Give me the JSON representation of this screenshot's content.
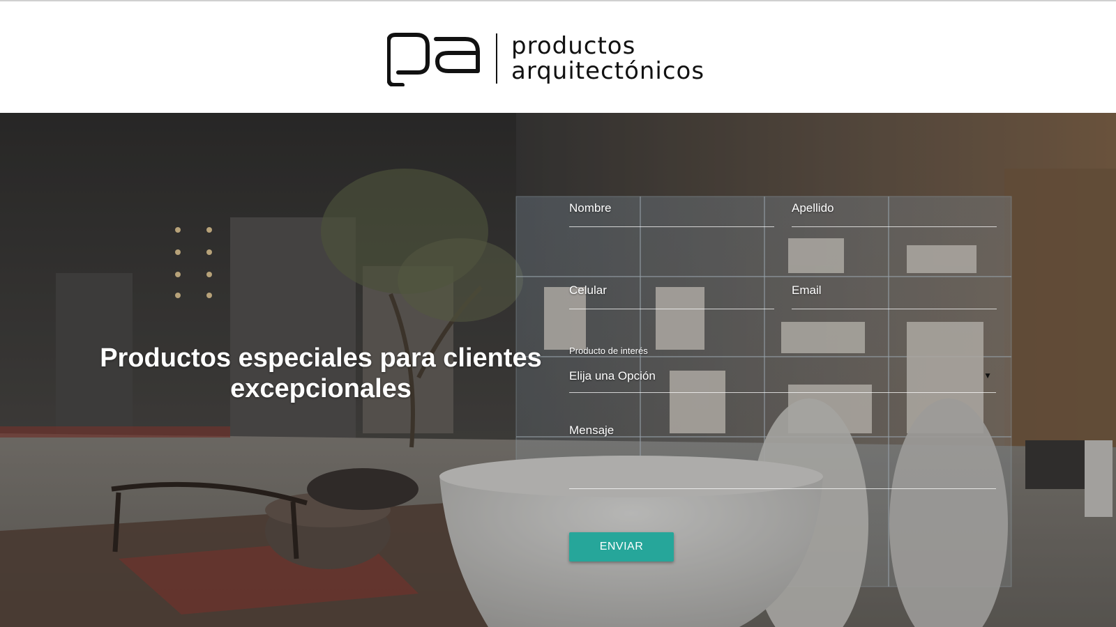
{
  "header": {
    "brand_line1": "productos",
    "brand_line2": "arquitectónicos",
    "logo_icon": "pa-logo-icon"
  },
  "hero": {
    "headline_line1": "Productos especiales para clientes",
    "headline_line2": "excepcionales"
  },
  "form": {
    "nombre_label": "Nombre",
    "apellido_label": "Apellido",
    "celular_label": "Celular",
    "email_label": "Email",
    "producto_label": "Producto de interés",
    "producto_selected": "Elija una Opción",
    "producto_arrow": "▼",
    "mensaje_label": "Mensaje",
    "submit_label": "ENVIAR"
  },
  "colors": {
    "accent": "#26a69a",
    "header_bg": "#ffffff",
    "text_light": "#ffffff"
  }
}
